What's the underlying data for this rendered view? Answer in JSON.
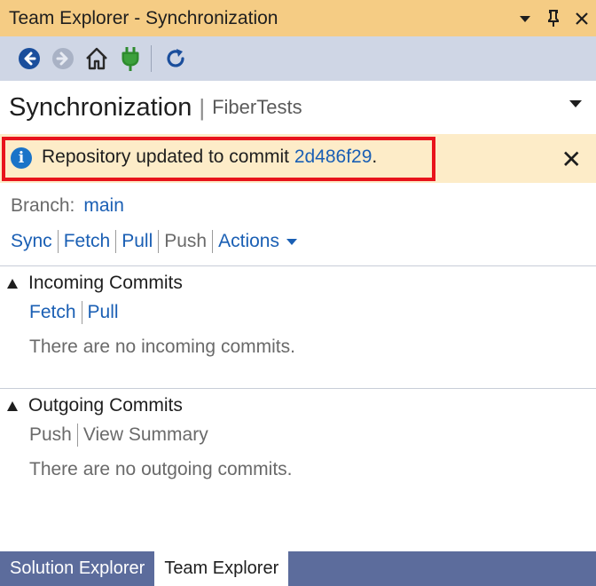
{
  "window": {
    "title": "Team Explorer - Synchronization",
    "controls": [
      "dropdown",
      "pin",
      "close"
    ]
  },
  "toolbar": {
    "buttons": [
      "back-icon",
      "forward-icon",
      "home-icon",
      "connect-icon",
      "refresh-icon"
    ]
  },
  "header": {
    "title": "Synchronization",
    "separator": "|",
    "subtitle": "FiberTests"
  },
  "infobar": {
    "message": "Repository updated to commit ",
    "commit": "2d486f29",
    "suffix": ".",
    "close": "✕"
  },
  "branch": {
    "label": "Branch:",
    "value": "main"
  },
  "actions": {
    "sync": "Sync",
    "fetch": "Fetch",
    "pull": "Pull",
    "push": "Push",
    "actions": "Actions"
  },
  "incoming": {
    "title": "Incoming Commits",
    "fetch": "Fetch",
    "pull": "Pull",
    "message": "There are no incoming commits."
  },
  "outgoing": {
    "title": "Outgoing Commits",
    "push": "Push",
    "view_summary": "View Summary",
    "message": "There are no outgoing commits."
  },
  "tabs": [
    {
      "label": "Solution Explorer",
      "active": false
    },
    {
      "label": "Team Explorer",
      "active": true
    }
  ],
  "colors": {
    "titlebar": "#f5cc84",
    "toolbar": "#cfd6e5",
    "infobar": "#fdecc8",
    "highlight": "#e8141c",
    "link": "#1a5fb4",
    "tabbar": "#5c6c9c"
  }
}
